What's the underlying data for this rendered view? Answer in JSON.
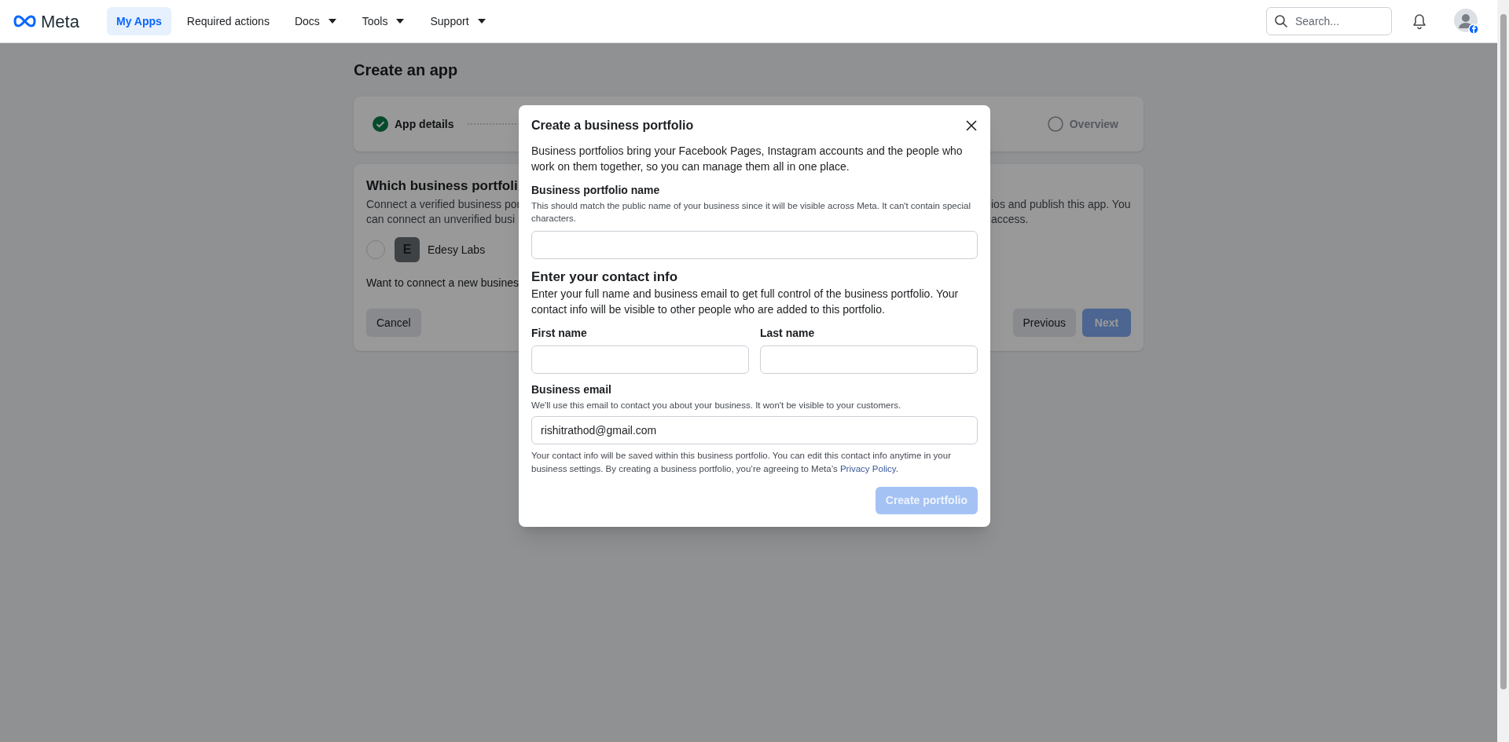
{
  "nav": {
    "logo": "Meta",
    "items": [
      {
        "label": "My Apps",
        "selected": true,
        "dropdown": false
      },
      {
        "label": "Required actions",
        "selected": false,
        "dropdown": false
      },
      {
        "label": "Docs",
        "selected": false,
        "dropdown": true
      },
      {
        "label": "Tools",
        "selected": false,
        "dropdown": true
      },
      {
        "label": "Support",
        "selected": false,
        "dropdown": true
      }
    ],
    "search": {
      "placeholder": "Search..."
    }
  },
  "page": {
    "title": "Create an app",
    "steps": [
      {
        "label": "App details",
        "done": true
      },
      {
        "label": "Overview",
        "done": false
      }
    ],
    "section": {
      "title": "Which business portfoli",
      "description_left": [
        "Connect a verified business por",
        "can connect an unverified busi"
      ],
      "description_right": [
        "ios and publish this app. You",
        "access."
      ],
      "portfolios": [
        {
          "initial": "E",
          "name": "Edesy Labs",
          "selected": false
        }
      ],
      "connect_prompt": "Want to connect a new busines"
    },
    "buttons": [
      {
        "label": "Cancel",
        "kind": "secondary",
        "disabled": false
      },
      {
        "label": "Previous",
        "kind": "secondary",
        "disabled": false
      },
      {
        "label": "Next",
        "kind": "primary",
        "disabled": true
      }
    ]
  },
  "modal": {
    "title": "Create a business portfolio",
    "description": "Business portfolios bring your Facebook Pages, Instagram accounts and the people who work on them together, so you can manage them all in one place.",
    "portfolio_name": {
      "label": "Business portfolio name",
      "help": "This should match the public name of your business since it will be visible across Meta. It can't contain special characters."
    },
    "contact_heading": "Enter your contact info",
    "contact_description": "Enter your full name and business email to get full control of the business portfolio. Your contact info will be visible to other people who are added to this portfolio.",
    "first_name": {
      "label": "First name"
    },
    "last_name": {
      "label": "Last name"
    },
    "email": {
      "label": "Business email",
      "help": "We'll use this email to contact you about your business. It won't be visible to your customers.",
      "value": "rishitrathod@gmail.com"
    },
    "footer_text": "Your contact info will be saved within this business portfolio. You can edit this contact info anytime in your business settings. By creating a business portfolio, you’re agreeing to Meta’s ",
    "footer_link": "Privacy Policy",
    "footer_end": ".",
    "submit": {
      "label": "Create portfolio",
      "disabled": true
    }
  }
}
